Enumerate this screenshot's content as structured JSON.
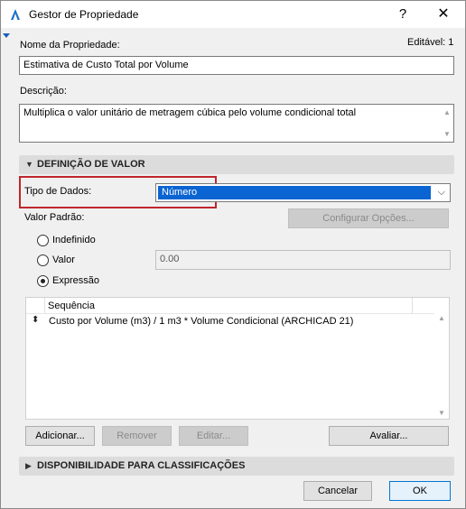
{
  "window": {
    "title": "Gestor de Propriedade",
    "help_glyph": "?",
    "close_glyph": "✕"
  },
  "property": {
    "name_label": "Nome da Propriedade:",
    "editable": "Editável: 1",
    "name_value": "Estimativa de Custo Total por Volume",
    "description_label": "Descrição:",
    "description_value": "Multiplica o valor unitário de metragem cúbica pelo volume condicional total"
  },
  "value_definition": {
    "section_title": "DEFINIÇÃO DE VALOR",
    "data_type_label": "Tipo de Dados:",
    "data_type_value": "Número",
    "configure_button": "Configurar Opções...",
    "default_value_label": "Valor Padrão:",
    "options": [
      {
        "label": "Indefinido",
        "checked": false
      },
      {
        "label": "Valor",
        "checked": false
      },
      {
        "label": "Expressão",
        "checked": true
      }
    ],
    "value_field": "0.00",
    "sequence_header": "Sequência",
    "expression": "Custo por Volume (m3) / 1 m3 * Volume Condicional (ARCHICAD 21)",
    "buttons": {
      "add": "Adicionar...",
      "remove": "Remover",
      "edit": "Editar...",
      "evaluate": "Avaliar..."
    }
  },
  "classification": {
    "section_title": "DISPONIBILIDADE PARA CLASSIFICAÇÕES"
  },
  "footer": {
    "cancel": "Cancelar",
    "ok": "OK"
  },
  "colors": {
    "selection": "#0a64d2",
    "highlight_box": "#c0262c",
    "default_button_border": "#0078d7"
  }
}
